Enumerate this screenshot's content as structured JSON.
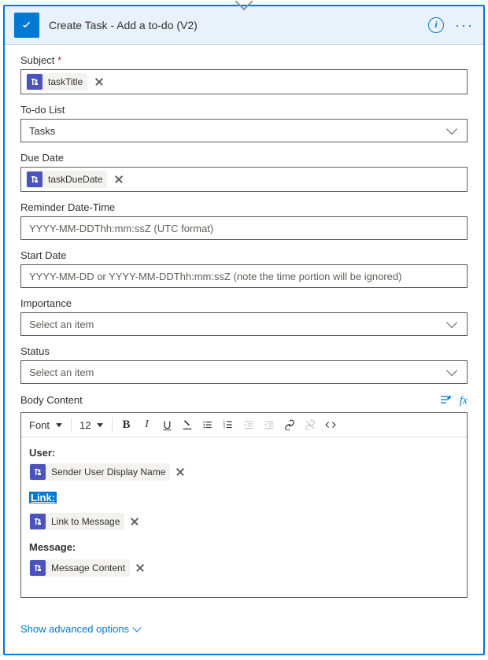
{
  "header": {
    "title": "Create Task - Add a to-do (V2)"
  },
  "fields": {
    "subject": {
      "label": "Subject",
      "token": "taskTitle"
    },
    "todoList": {
      "label": "To-do List",
      "value": "Tasks"
    },
    "dueDate": {
      "label": "Due Date",
      "token": "taskDueDate"
    },
    "reminder": {
      "label": "Reminder Date-Time",
      "placeholder": "YYYY-MM-DDThh:mm:ssZ (UTC format)"
    },
    "startDate": {
      "label": "Start Date",
      "placeholder": "YYYY-MM-DD or YYYY-MM-DDThh:mm:ssZ (note the time portion will be ignored)"
    },
    "importance": {
      "label": "Importance",
      "placeholder": "Select an item"
    },
    "status": {
      "label": "Status",
      "placeholder": "Select an item"
    },
    "bodyContent": {
      "label": "Body Content",
      "font": "Font",
      "size": "12",
      "segments": {
        "user": {
          "label": "User:",
          "token": "Sender User Display Name"
        },
        "link": {
          "label": "Link:",
          "token": "Link to Message"
        },
        "message": {
          "label": "Message:",
          "token": "Message Content"
        }
      }
    }
  },
  "footer": {
    "advanced": "Show advanced options"
  }
}
